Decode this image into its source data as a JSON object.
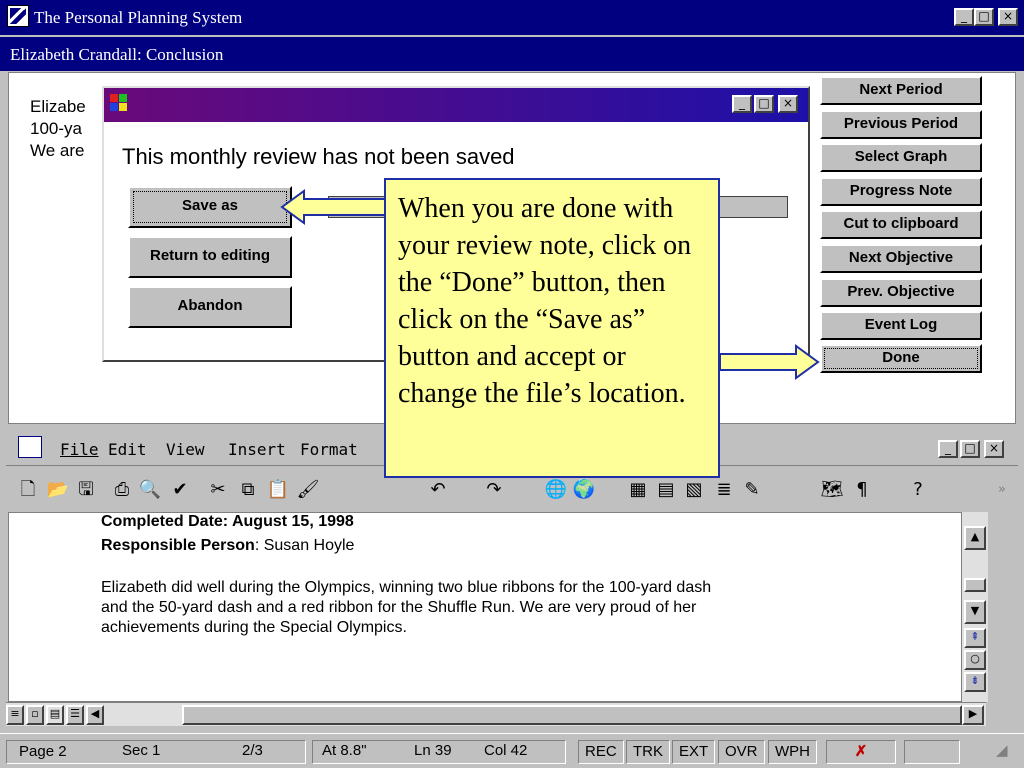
{
  "app": {
    "title": "The Personal Planning System",
    "subtitle": "Elizabeth Crandall: Conclusion"
  },
  "background_text": [
    "Elizabe",
    "100-ya",
    "We are"
  ],
  "side_buttons": [
    "Next Period",
    "Previous Period",
    "Select Graph",
    "Progress Note",
    "Cut to clipboard",
    "Next Objective",
    "Prev. Objective",
    "Event Log",
    "Done"
  ],
  "dialog": {
    "message": "This monthly review has not been saved",
    "buttons": [
      "Save as",
      "Return to editing",
      "Abandon"
    ]
  },
  "callout": {
    "text": "When you are done with your review note, click on the “Done” button, then click on the “Save as” button and accept or change the file’s location."
  },
  "word": {
    "menu": [
      "File",
      "Edit",
      "View",
      "Insert",
      "Format"
    ],
    "doc": {
      "completed_line": "Completed Date: August 15, 1998",
      "responsible_label": "Responsible Person",
      "responsible_value": ": Susan Hoyle",
      "paragraph": [
        "Elizabeth did well during the Olympics, winning two blue ribbons for the 100-yard dash",
        "and the 50-yard dash and a red ribbon for the Shuffle Run.   We are very proud of her",
        "achievements during the Special Olympics."
      ]
    },
    "status": {
      "page": "Page 2",
      "sec": "Sec 1",
      "pages": "2/3",
      "at": "At 8.8\"",
      "ln": "Ln 39",
      "col": "Col 42",
      "rec": "REC",
      "trk": "TRK",
      "ext": "EXT",
      "ovr": "OVR",
      "wph": "WPH"
    }
  },
  "window_controls": {
    "min": "_",
    "max": "□",
    "close": "×",
    "restore": "ə"
  },
  "colors": {
    "title_bar": "#000080",
    "callout_bg": "#ffff99",
    "callout_border": "#1e2fa6",
    "arrow": "#1e2fa6"
  }
}
